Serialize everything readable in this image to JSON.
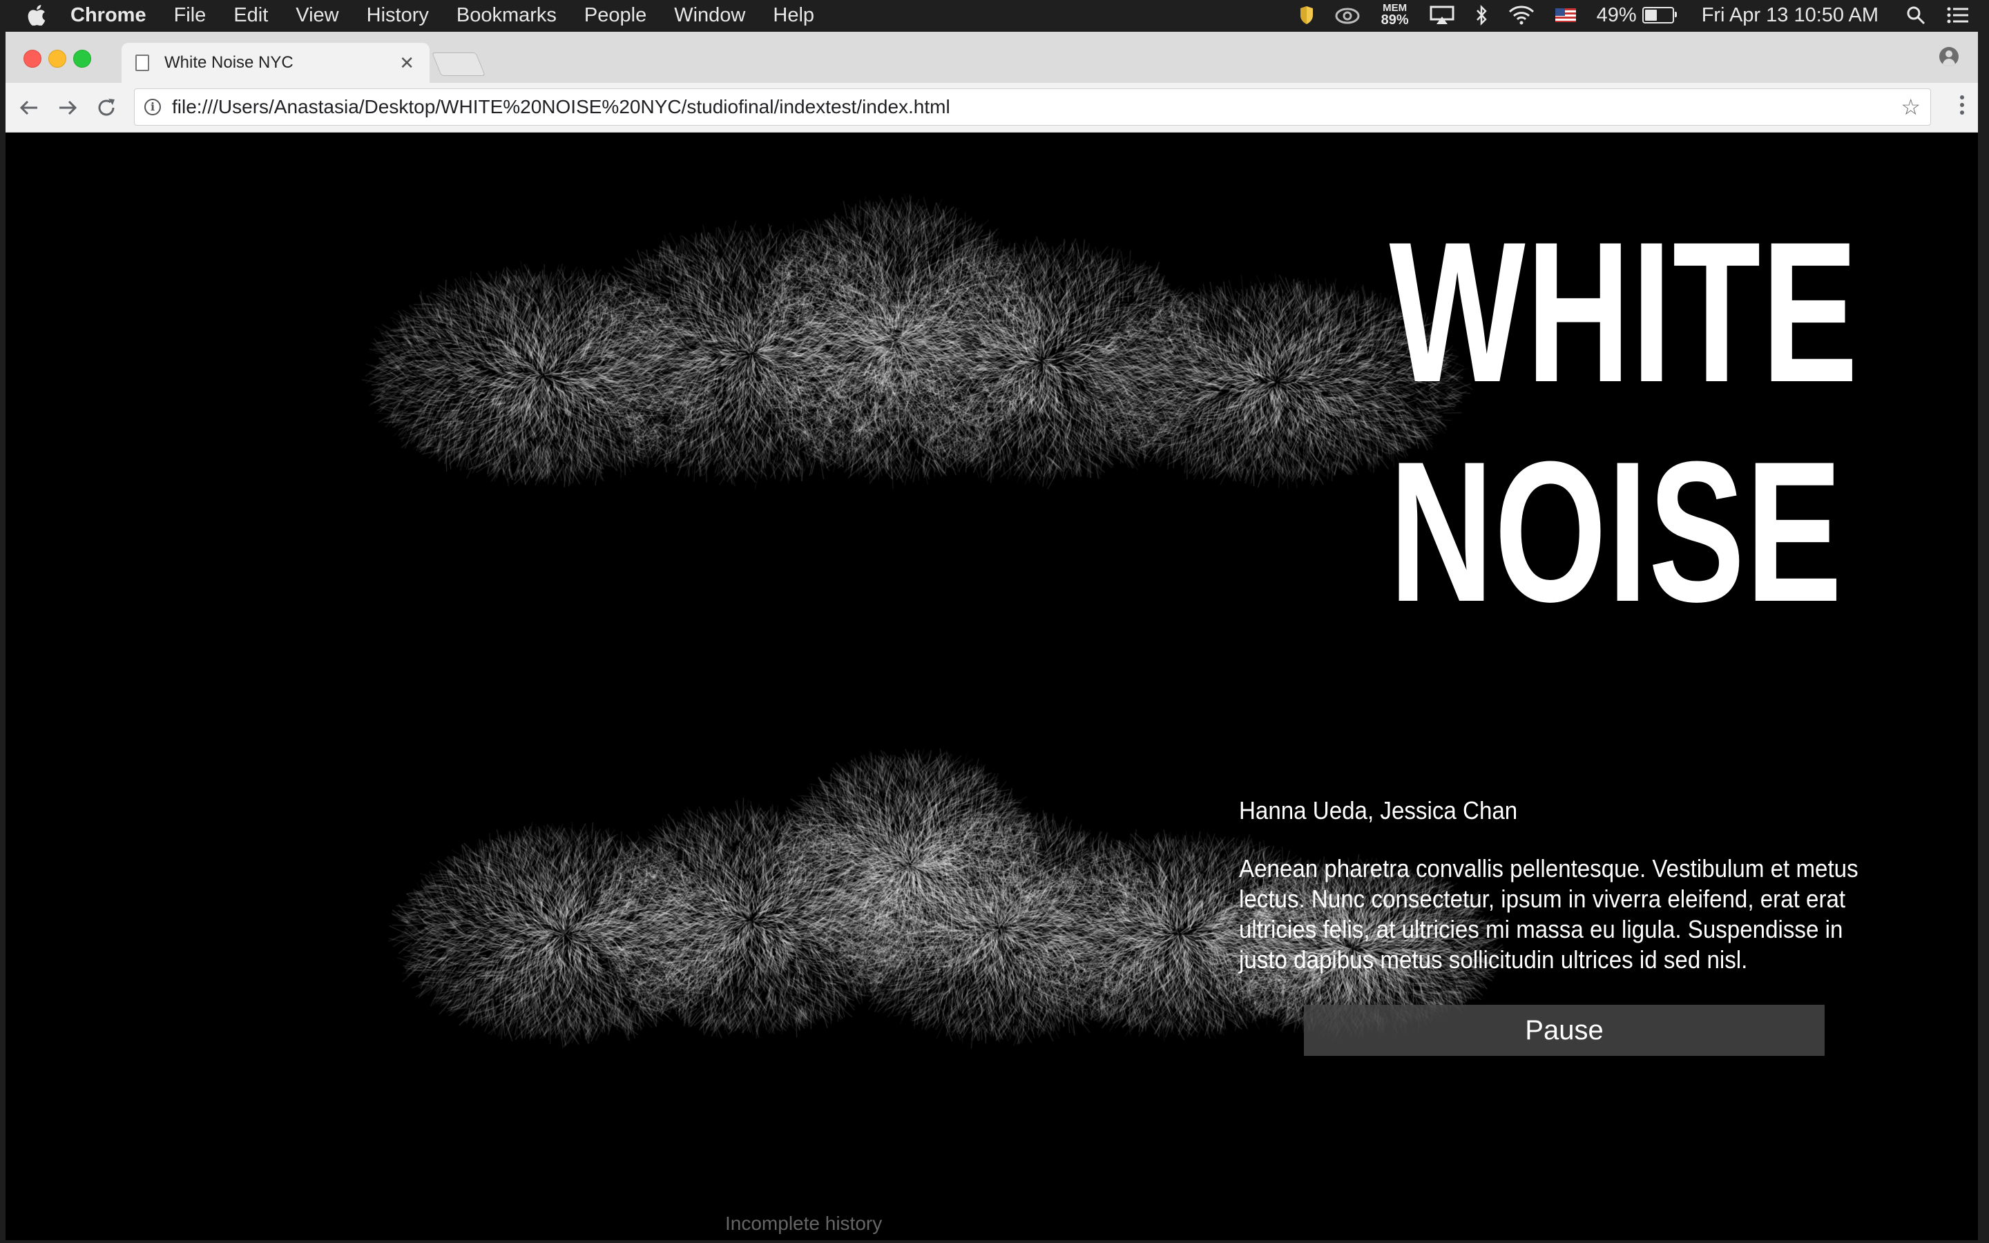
{
  "menubar": {
    "apple_icon": "apple-logo",
    "app_name": "Chrome",
    "items": [
      "File",
      "Edit",
      "View",
      "History",
      "Bookmarks",
      "People",
      "Window",
      "Help"
    ],
    "status": {
      "mem_label": "MEM",
      "mem_value": "89%",
      "battery_percent": "49%",
      "battery_level": 0.49,
      "datetime": "Fri Apr 13  10:50 AM"
    }
  },
  "browser": {
    "tab_title": "White Noise NYC",
    "url": "file:///Users/Anastasia/Desktop/WHITE%20NOISE%20NYC/studiofinal/indextest/index.html",
    "colors": {
      "tabstrip": "#dcdcdc",
      "toolbar": "#f2f2f2"
    }
  },
  "page": {
    "headline_line1": "WHITE",
    "headline_line2": "NOISE",
    "authors": "Hanna Ueda, Jessica Chan",
    "description": "Aenean pharetra convallis pellentesque. Vestibulum et metus lectus. Nunc consectetur, ipsum in viverra eleifend, erat erat ultricies felis, at ultricies mi massa eu ligula. Suspendisse in justo dapibus metus sollicitudin ultrices id sed nisl.",
    "pause_label": "Pause",
    "background": "#000000",
    "text_color": "#ffffff"
  },
  "overlay_text": "Incomplete history"
}
